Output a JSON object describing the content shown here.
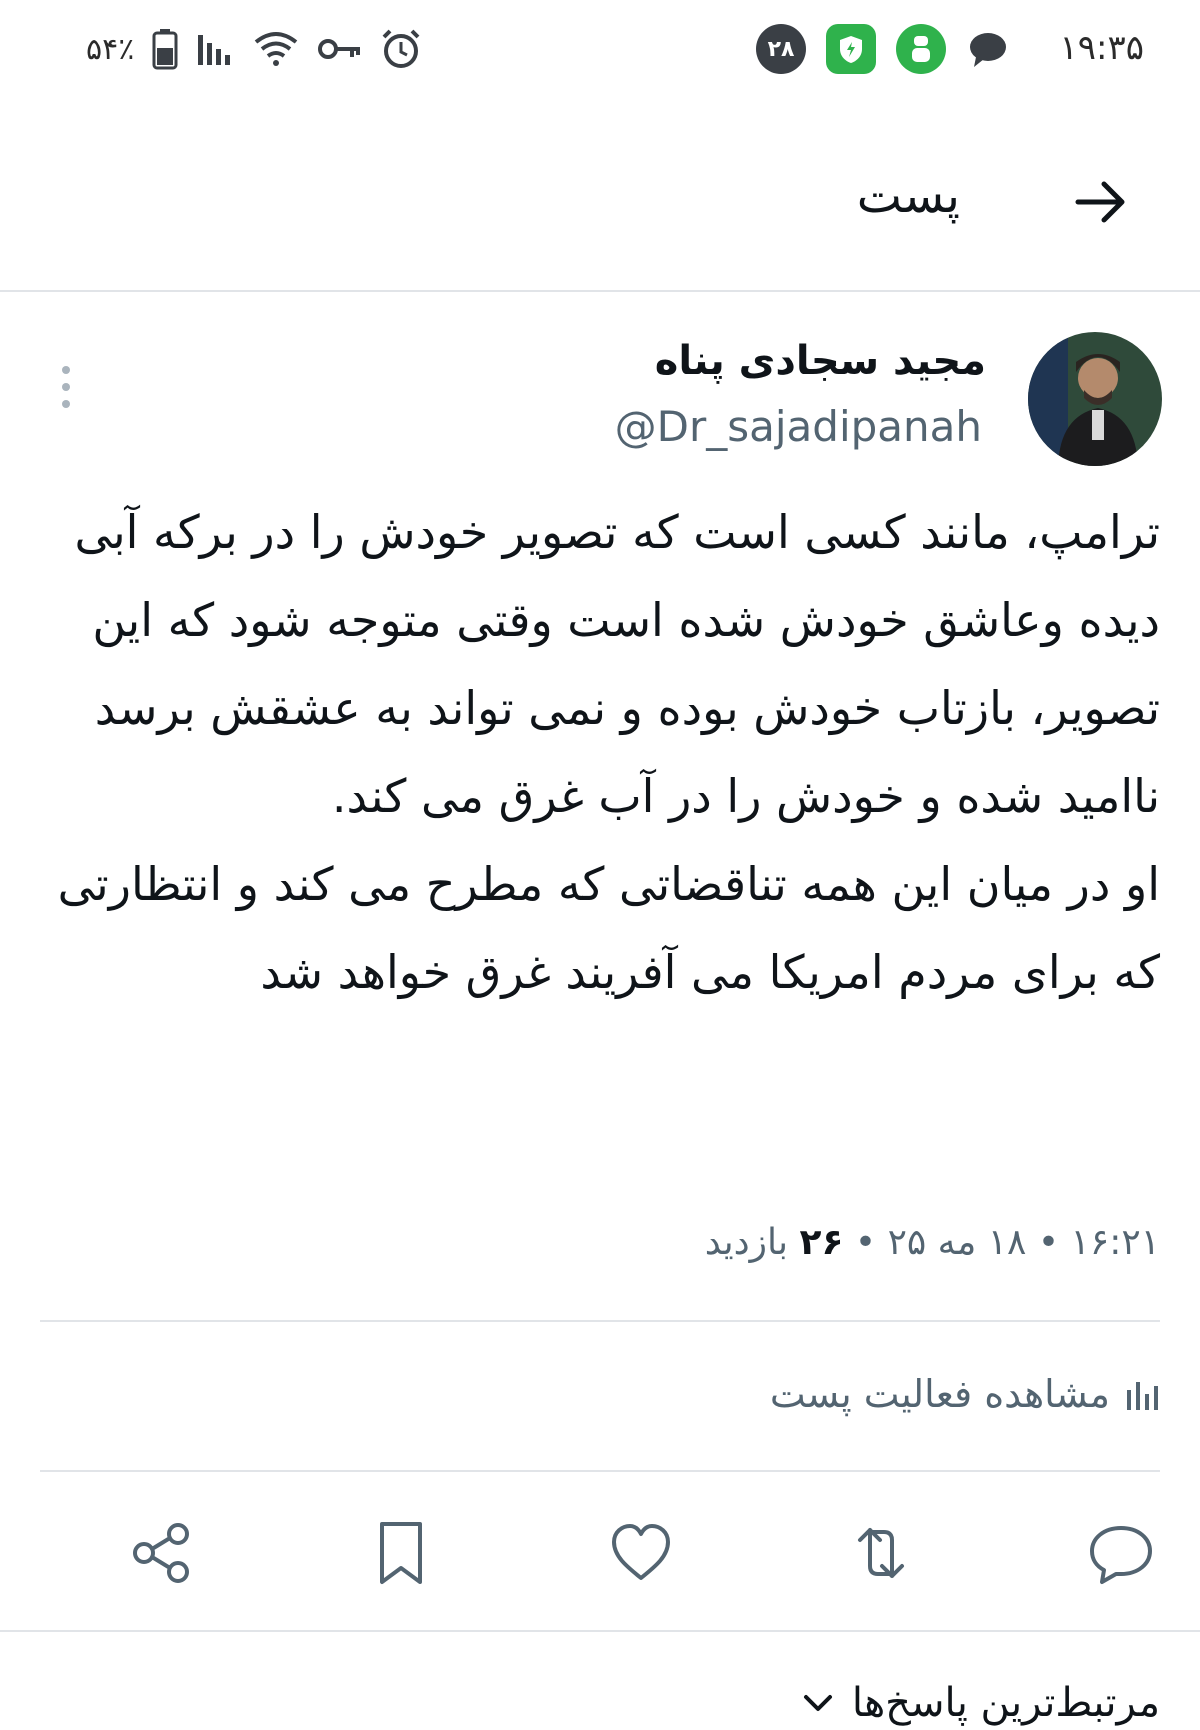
{
  "status_bar": {
    "time": "۱۹:۳۵",
    "notification_count": "۲۸",
    "battery_percent": "۵۴٪",
    "icons": [
      "chat-icon",
      "app-green-icon",
      "shield-app-icon",
      "alarm-icon",
      "vpn-key-icon",
      "wifi-icon",
      "signal-icon",
      "battery-icon"
    ]
  },
  "header": {
    "title": "پست",
    "back_icon": "arrow-right-icon"
  },
  "author": {
    "name": "مجید سجادی پناه",
    "handle": "@Dr_sajadipanah"
  },
  "tweet": {
    "paragraphs": [
      "ترامپ، مانند کسی است که تصویر خودش را در برکه آبی دیده وعاشق خودش شده است وقتی متوجه شود که این تصویر، بازتاب خودش بوده و نمی تواند به عشقش برسد ناامید شده و خودش را در آب غرق می کند.",
      "او در میان این همه تناقضاتی که مطرح می کند و انتظارتی که برای مردم امریکا می آفریند غرق خواهد شد"
    ],
    "meta_time": "۱۶:۲۱ • ۱۸ مه ۲۵ •",
    "meta_views_count": "۲۶",
    "meta_views_label": "بازدید"
  },
  "activity": {
    "label": "مشاهده فعالیت پست"
  },
  "actions": [
    "reply-icon",
    "retweet-icon",
    "like-icon",
    "bookmark-icon",
    "share-icon"
  ],
  "replies_sort": {
    "label": "مرتبط‌ترین پاسخ‌ها"
  },
  "colors": {
    "text": "#0f1419",
    "secondary": "#536471",
    "divider": "#e1e4e8",
    "badge_dark": "#3a3f45",
    "badge_green": "#2fb24c"
  }
}
